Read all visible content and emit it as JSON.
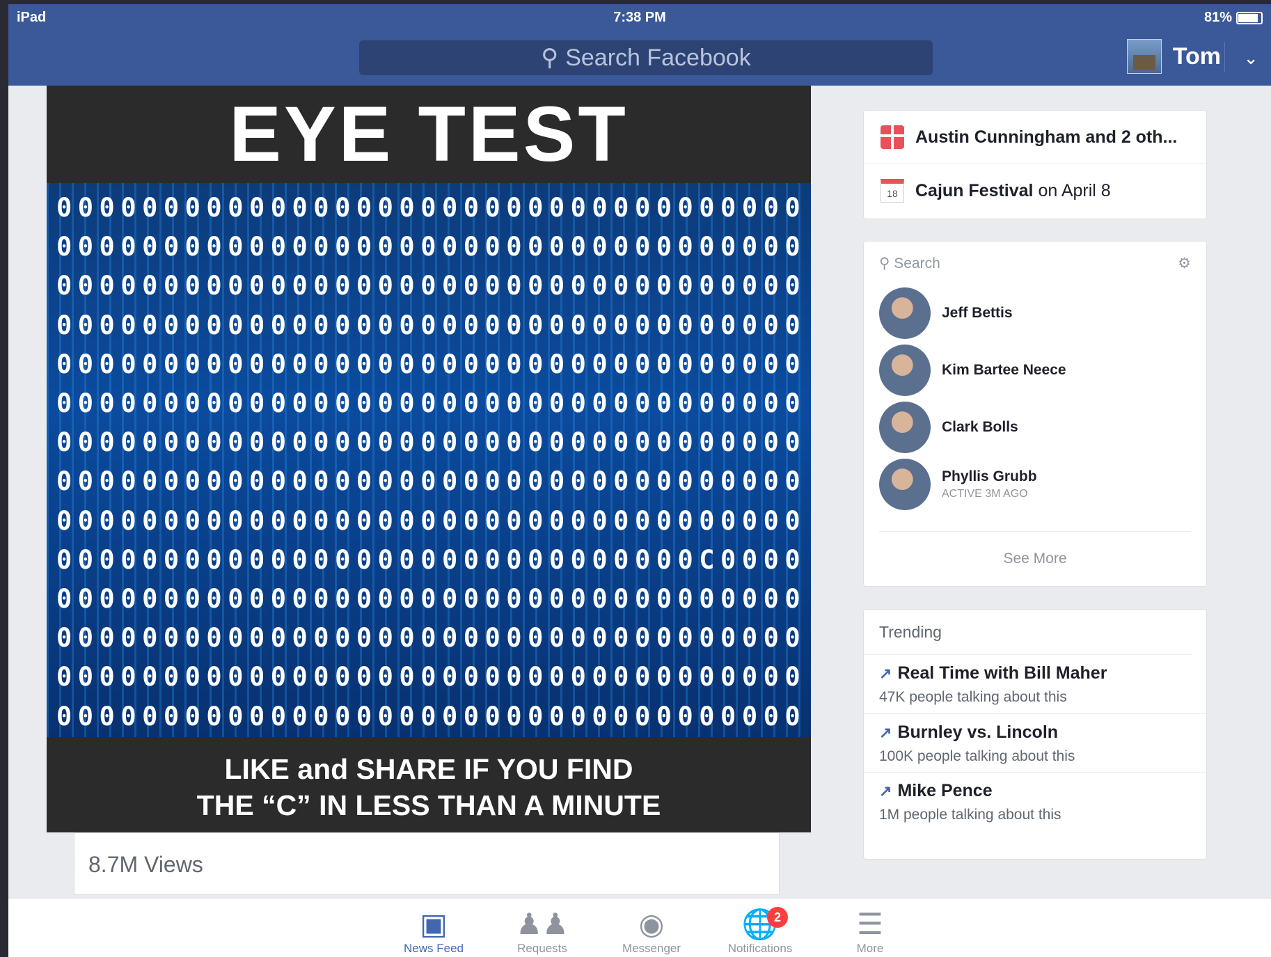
{
  "status": {
    "device": "iPad",
    "time": "7:38 PM",
    "battery": "81%",
    "battery_level": 0.81
  },
  "header": {
    "search_placeholder": "Search Facebook",
    "user_name": "Tom"
  },
  "post": {
    "title": "EYE TEST",
    "grid_rows": [
      "00000000000000000000000000000000000",
      "00000000000000000000000000000000000",
      "00000000000000000000000000000000000",
      "00000000000000000000000000000000000",
      "00000000000000000000000000000000000",
      "00000000000000000000000000000000000",
      "00000000000000000000000000000000000",
      "00000000000000000000000000000000000",
      "00000000000000000000000000000000000",
      "000000000000000000000000000000C0000",
      "00000000000000000000000000000000000",
      "00000000000000000000000000000000000",
      "00000000000000000000000000000000000",
      "00000000000000000000000000000000000"
    ],
    "caption_line1": "LIKE and SHARE IF YOU FIND",
    "caption_line2": "THE “C” IN LESS THAN A MINUTE",
    "views": "8.7M Views"
  },
  "events": [
    {
      "bold": "Austin Cunningham and 2 oth...",
      "rest": "",
      "icon": "gift-icon"
    },
    {
      "bold": "Cajun Festival",
      "rest": " on April 8",
      "icon": "calendar-icon",
      "day": "18"
    }
  ],
  "chat": {
    "search_placeholder": "Search",
    "friends": [
      {
        "name": "Jeff Bettis",
        "status": ""
      },
      {
        "name": "Kim Bartee Neece",
        "status": ""
      },
      {
        "name": "Clark Bolls",
        "status": ""
      },
      {
        "name": "Phyllis Grubb",
        "status": "ACTIVE 3M AGO"
      }
    ],
    "see_more": "See More"
  },
  "trending": {
    "heading": "Trending",
    "items": [
      {
        "title": "Real Time with Bill Maher",
        "sub": "47K people talking about this"
      },
      {
        "title": "Burnley vs. Lincoln",
        "sub": "100K people talking about this"
      },
      {
        "title": "Mike Pence",
        "sub": "1M people talking about this"
      }
    ]
  },
  "tabs": [
    {
      "label": "News Feed",
      "icon": "news-feed-icon",
      "active": true
    },
    {
      "label": "Requests",
      "icon": "requests-icon"
    },
    {
      "label": "Messenger",
      "icon": "messenger-icon"
    },
    {
      "label": "Notifications",
      "icon": "notifications-icon",
      "badge": "2"
    },
    {
      "label": "More",
      "icon": "menu-icon"
    }
  ]
}
